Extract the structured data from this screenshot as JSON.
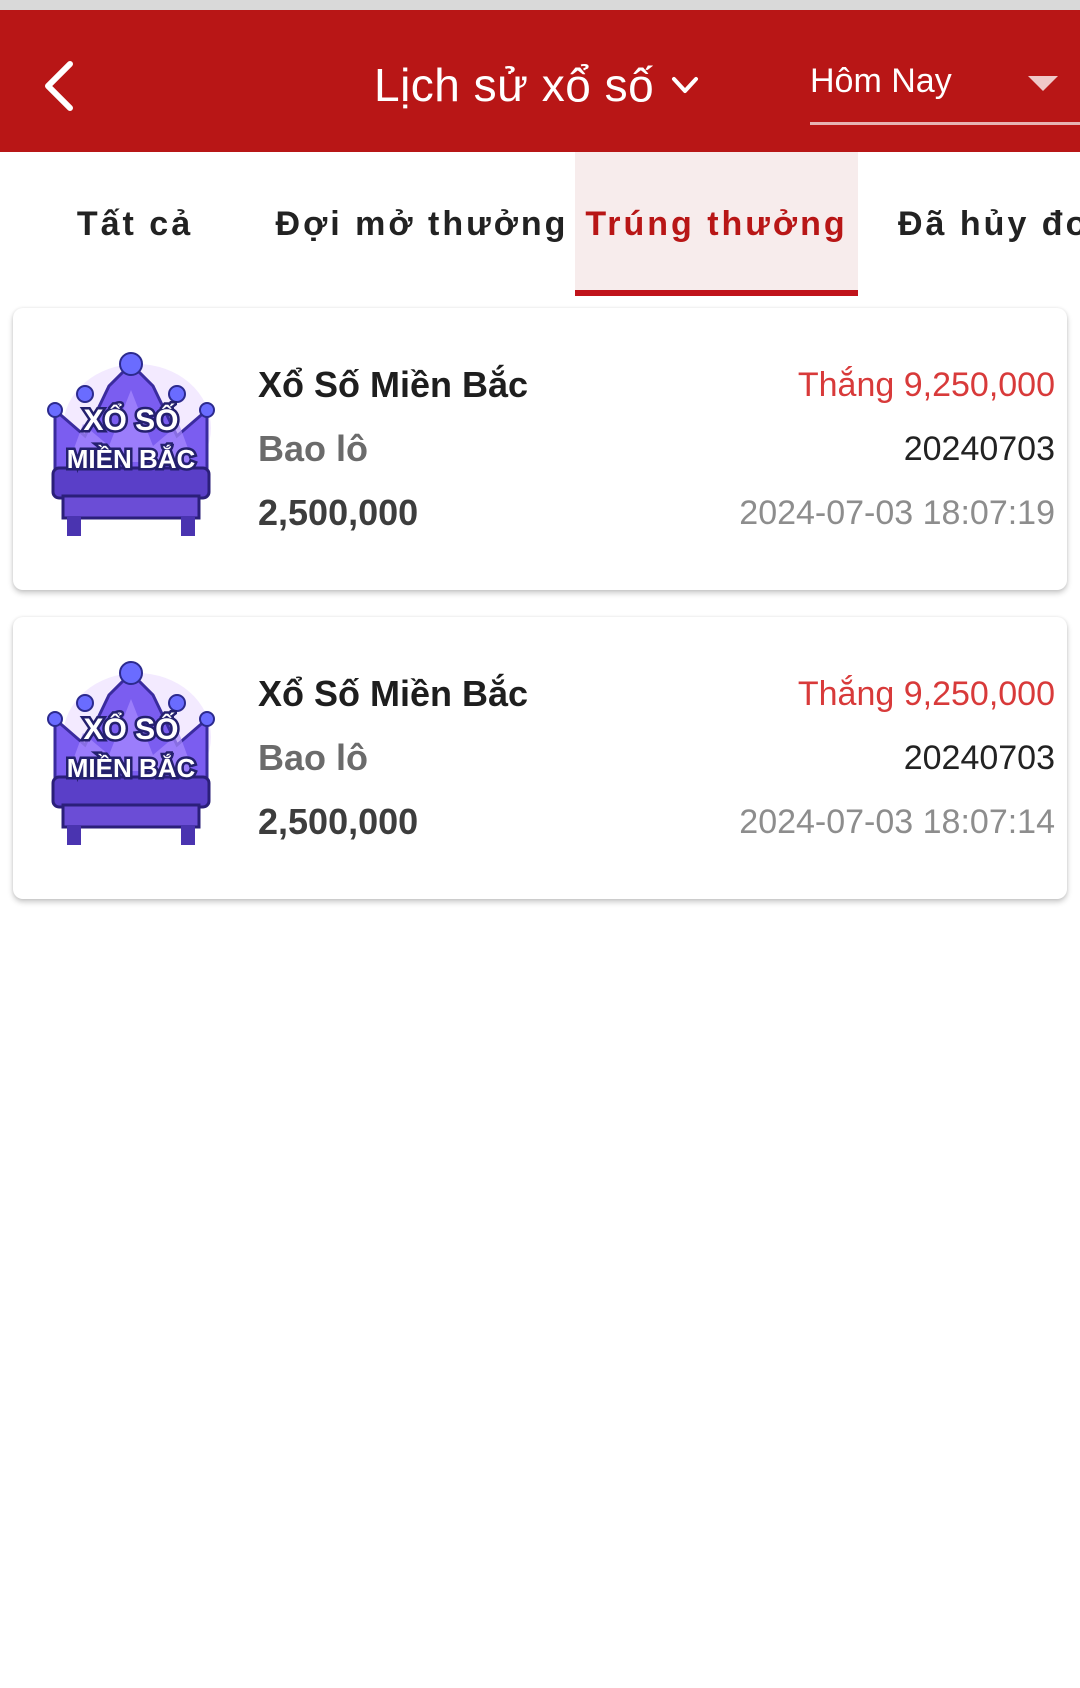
{
  "header": {
    "title": "Lịch sử xổ số",
    "date_filter": "Hôm Nay"
  },
  "tabs": [
    {
      "label": "Tất cả"
    },
    {
      "label": "Đợi mở thưởng"
    },
    {
      "label": "Trúng thưởng"
    },
    {
      "label": "Đã hủy đơn"
    }
  ],
  "active_tab_index": 2,
  "records": [
    {
      "logo_text": [
        "XỔ SỐ",
        "MIỀN BẮC"
      ],
      "game": "Xổ Số Miền Bắc",
      "bet_type": "Bao lô",
      "amount": "2,500,000",
      "win_label": "Thắng",
      "win_amount": "9,250,000",
      "issue": "20240703",
      "time": "2024-07-03 18:07:19"
    },
    {
      "logo_text": [
        "XỔ SỐ",
        "MIỀN BẮC"
      ],
      "game": "Xổ Số Miền Bắc",
      "bet_type": "Bao lô",
      "amount": "2,500,000",
      "win_label": "Thắng",
      "win_amount": "9,250,000",
      "issue": "20240703",
      "time": "2024-07-03 18:07:14"
    }
  ],
  "colors": {
    "header_bg": "#b81616",
    "accent": "#c0141b",
    "win_text": "#d83a3a",
    "logo_purple": "#6d4fe0"
  },
  "icons": [
    "back-arrow-icon",
    "chevron-down-icon",
    "dropdown-caret-icon",
    "lottery-logo-icon"
  ]
}
